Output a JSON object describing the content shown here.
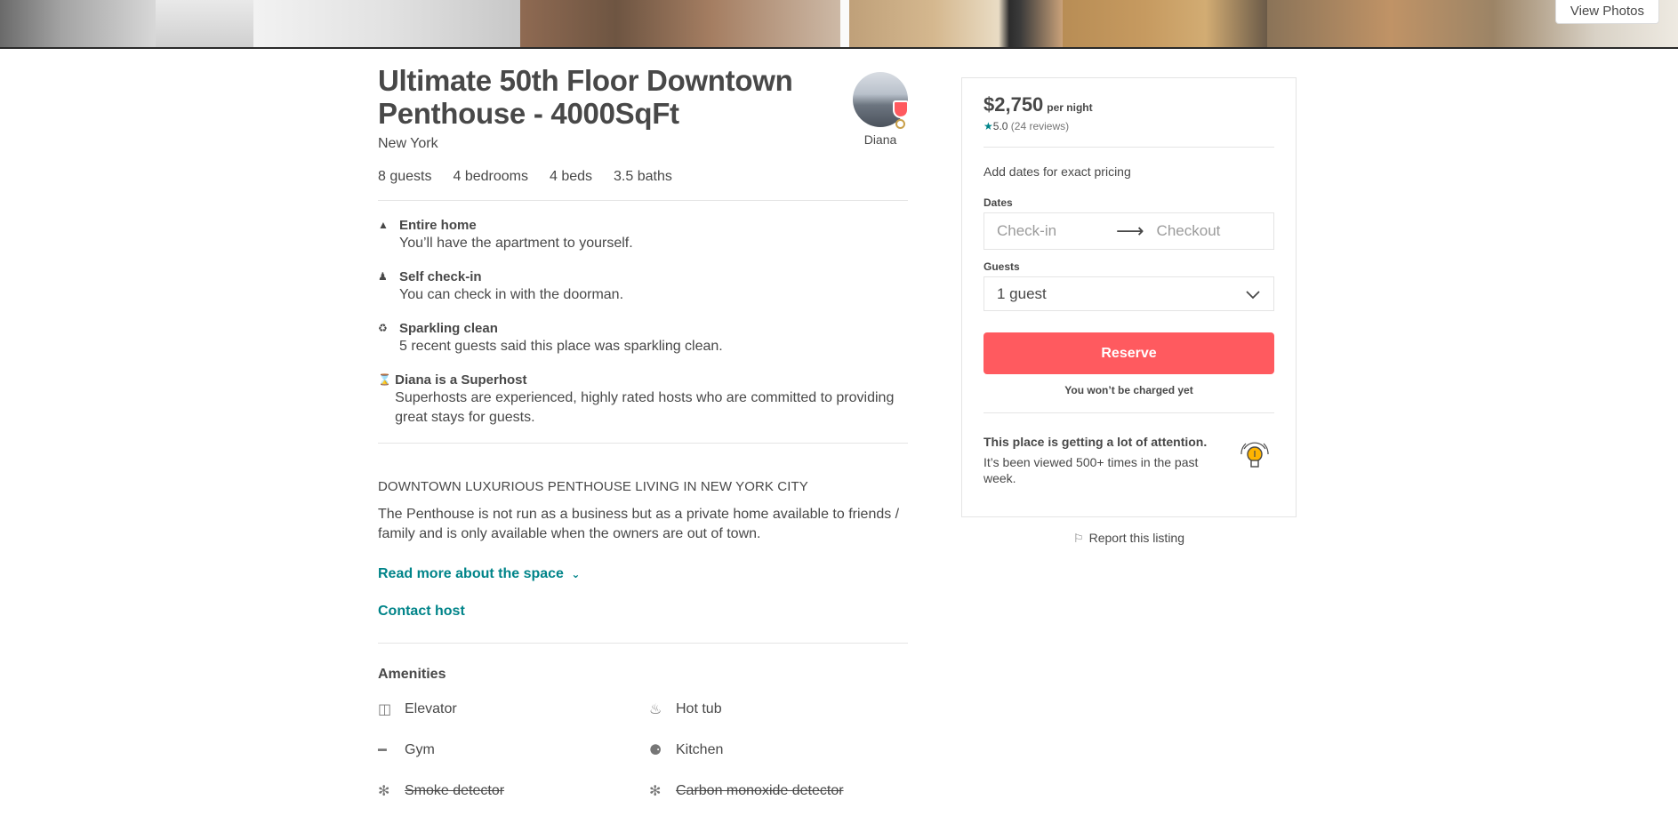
{
  "hero": {
    "view_photos_label": "View Photos"
  },
  "listing": {
    "title": "Ultimate 50th Floor Downtown Penthouse - 4000SqFt",
    "city": "New York",
    "host_name": "Diana",
    "stats": [
      "8 guests",
      "4 bedrooms",
      "4 beds",
      "3.5 baths"
    ]
  },
  "features": [
    {
      "icon": "home-icon",
      "title": "Entire home",
      "desc": "You’ll have the apartment to yourself."
    },
    {
      "icon": "doorman-icon",
      "title": "Self check-in",
      "desc": "You can check in with the doorman."
    },
    {
      "icon": "spray-bottle-icon",
      "title": "Sparkling clean",
      "desc": "5 recent guests said this place was sparkling clean."
    },
    {
      "icon": "medal-icon",
      "title": "Diana is a Superhost",
      "desc": "Superhosts are experienced, highly rated hosts who are committed to providing great stays for guests."
    }
  ],
  "summary": {
    "title": "DOWNTOWN LUXURIOUS PENTHOUSE LIVING IN NEW YORK CITY",
    "body": "The Penthouse is not run as a business but as a private home available to friends / family and is only available when the owners are out of town.",
    "read_more": "Read more about the space",
    "contact_host": "Contact host"
  },
  "amenities": {
    "title": "Amenities",
    "items": [
      {
        "icon": "elevator-icon",
        "label": "Elevator",
        "unavailable": false
      },
      {
        "icon": "hot-tub-icon",
        "label": "Hot tub",
        "unavailable": false
      },
      {
        "icon": "dumbbell-icon",
        "label": "Gym",
        "unavailable": false
      },
      {
        "icon": "fork-knife-icon",
        "label": "Kitchen",
        "unavailable": false
      },
      {
        "icon": "detector-icon",
        "label": "Smoke detector",
        "unavailable": true
      },
      {
        "icon": "detector-icon",
        "label": "Carbon monoxide detector",
        "unavailable": true
      }
    ]
  },
  "booking": {
    "price": "$2,750",
    "per_night": "per night",
    "rating": "5.0",
    "reviews": "(24 reviews)",
    "pricing_hint": "Add dates for exact pricing",
    "dates_label": "Dates",
    "checkin_placeholder": "Check-in",
    "checkout_placeholder": "Checkout",
    "guests_label": "Guests",
    "guests_value": "1 guest",
    "reserve_label": "Reserve",
    "charged_note": "You won’t be charged yet",
    "attention_title": "This place is getting a lot of attention.",
    "attention_desc": "It’s been viewed 500+ times in the past week."
  },
  "report_label": "Report this listing",
  "colors": {
    "accent": "#ff5a5f",
    "link": "#008489",
    "text": "#484848"
  }
}
